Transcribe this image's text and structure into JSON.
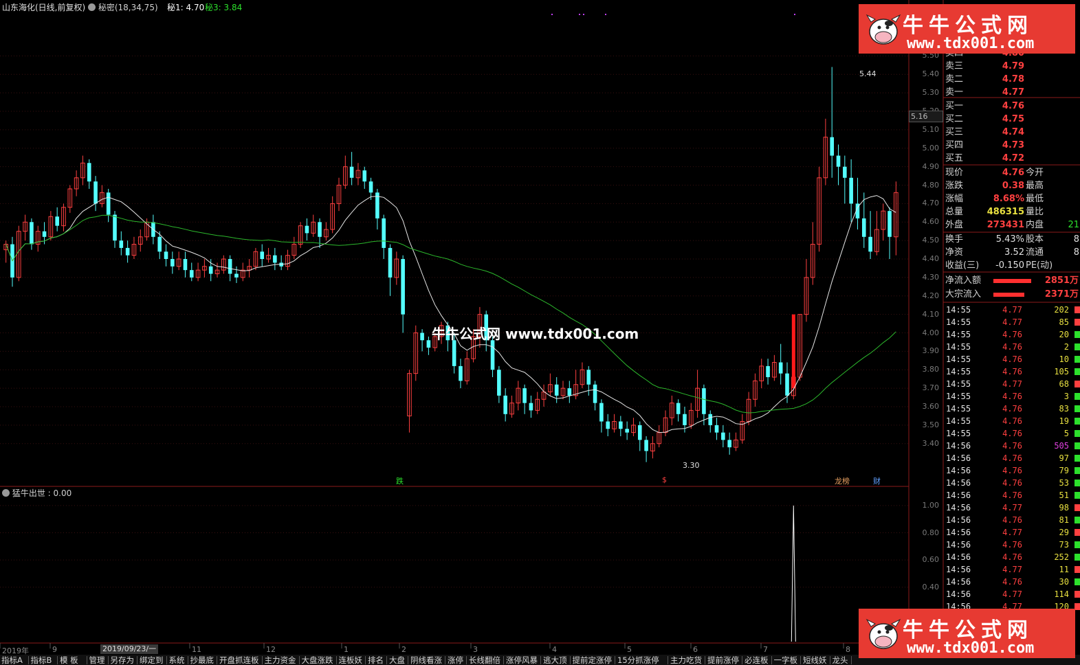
{
  "header": {
    "stock_title": "山东海化(日线,前复权)",
    "formula_name": "秘密(18,34,75)",
    "mi1_label": "秘1: 4.70",
    "mi3_label": "秘3: 3.84"
  },
  "sub_indicator": {
    "label": "猛牛出世 : 0.00"
  },
  "watermark": {
    "center_text": "牛牛公式网 www.tdx001.com",
    "brand_name": "牛牛公式网",
    "brand_url": "www.tdx001.com"
  },
  "price_axis": {
    "labels": [
      "5.50",
      "5.40",
      "5.30",
      "5.20",
      "5.10",
      "5.00",
      "4.90",
      "4.80",
      "4.70",
      "4.60",
      "4.50",
      "4.40",
      "4.30",
      "4.20",
      "4.10",
      "4.00",
      "3.90",
      "3.80",
      "3.70",
      "3.60",
      "3.50",
      "3.40"
    ],
    "current_marker": "5.16"
  },
  "sub_axis": {
    "labels": [
      "1.00",
      "0.80",
      "0.60",
      "0.40"
    ]
  },
  "annotations": {
    "high_label": "5.44",
    "low_label": "3.30",
    "marker_die": "跌",
    "marker_dollar": "$",
    "marker_bang": "龙榜",
    "marker_cai": "财"
  },
  "x_axis": {
    "labels": [
      "2019年",
      "9",
      "11",
      "12",
      "1",
      "2",
      "3",
      "4",
      "5",
      "6",
      "7",
      "8"
    ],
    "cursor_date": "2019/09/23/一"
  },
  "order_book": {
    "asks": [
      {
        "label": "卖四",
        "price": "4.80"
      },
      {
        "label": "卖三",
        "price": "4.79"
      },
      {
        "label": "卖二",
        "price": "4.78"
      },
      {
        "label": "卖一",
        "price": "4.77"
      }
    ],
    "bids": [
      {
        "label": "买一",
        "price": "4.76"
      },
      {
        "label": "买二",
        "price": "4.75"
      },
      {
        "label": "买三",
        "price": "4.74"
      },
      {
        "label": "买四",
        "price": "4.73"
      },
      {
        "label": "买五",
        "price": "4.72"
      }
    ]
  },
  "quote": [
    {
      "l1": "现价",
      "v1": "4.76",
      "l2": "今开",
      "v2": ""
    },
    {
      "l1": "涨跌",
      "v1": "0.38",
      "l2": "最高",
      "v2": ""
    },
    {
      "l1": "涨幅",
      "v1": "8.68%",
      "l2": "最低",
      "v2": ""
    },
    {
      "l1": "总量",
      "v1": "486315",
      "l2": "量比",
      "v2": ""
    },
    {
      "l1": "外盘",
      "v1": "273431",
      "l2": "内盘",
      "v2": "21"
    }
  ],
  "stats": [
    {
      "l1": "换手",
      "v1": "5.43%",
      "l2": "股本",
      "v2": "8"
    },
    {
      "l1": "净资",
      "v1": "3.52",
      "l2": "流通",
      "v2": "8"
    },
    {
      "l1": "收益(三)",
      "v1": "-0.150",
      "l2": "PE(动)",
      "v2": ""
    }
  ],
  "flows": [
    {
      "label": "净流入额",
      "value": "2851万"
    },
    {
      "label": "大宗流入",
      "value": "2371万"
    }
  ],
  "ticks": [
    {
      "time": "14:55",
      "price": "4.77",
      "vol": "202"
    },
    {
      "time": "14:55",
      "price": "4.77",
      "vol": "85"
    },
    {
      "time": "14:55",
      "price": "4.76",
      "vol": "20"
    },
    {
      "time": "14:55",
      "price": "4.76",
      "vol": "2"
    },
    {
      "time": "14:55",
      "price": "4.76",
      "vol": "10"
    },
    {
      "time": "14:55",
      "price": "4.76",
      "vol": "105"
    },
    {
      "time": "14:55",
      "price": "4.77",
      "vol": "68"
    },
    {
      "time": "14:55",
      "price": "4.76",
      "vol": "3"
    },
    {
      "time": "14:55",
      "price": "4.76",
      "vol": "83"
    },
    {
      "time": "14:55",
      "price": "4.76",
      "vol": "19"
    },
    {
      "time": "14:55",
      "price": "4.76",
      "vol": "5"
    },
    {
      "time": "14:56",
      "price": "4.76",
      "vol": "505"
    },
    {
      "time": "14:56",
      "price": "4.76",
      "vol": "97"
    },
    {
      "time": "14:56",
      "price": "4.76",
      "vol": "79"
    },
    {
      "time": "14:56",
      "price": "4.76",
      "vol": "53"
    },
    {
      "time": "14:56",
      "price": "4.76",
      "vol": "51"
    },
    {
      "time": "14:56",
      "price": "4.77",
      "vol": "98"
    },
    {
      "time": "14:56",
      "price": "4.76",
      "vol": "81"
    },
    {
      "time": "14:56",
      "price": "4.77",
      "vol": "29"
    },
    {
      "time": "14:56",
      "price": "4.76",
      "vol": "73"
    },
    {
      "time": "14:56",
      "price": "4.76",
      "vol": "252"
    },
    {
      "time": "14:56",
      "price": "4.77",
      "vol": "11"
    },
    {
      "time": "14:56",
      "price": "4.76",
      "vol": "30"
    },
    {
      "time": "14:56",
      "price": "4.77",
      "vol": "114"
    },
    {
      "time": "14:56",
      "price": "4.77",
      "vol": "120"
    }
  ],
  "tabs": [
    "指标A",
    "指标B",
    "模 板",
    "管理",
    "另存为",
    "绑定到",
    "系统",
    "抄最底",
    "开盘抓连板",
    "主力资金",
    "大盘涨跌",
    "连板妖",
    "排名",
    "大盘",
    "阴线看涨",
    "涨停",
    "长线翻倍",
    "涨停风暴",
    "逃大顶",
    "提前定涨停",
    "15分抓涨停",
    "主力吃货",
    "提前涨停",
    "必连板",
    "一字板",
    "短线妖",
    "龙头"
  ],
  "colors": {
    "up": "#ff4040",
    "down": "#54ffff",
    "ma_short": "#e6e6e6",
    "ma_long": "#2cb82c",
    "brand": "#e73a32"
  },
  "chart_data": {
    "type": "candlestick",
    "ylim": [
      3.28,
      5.55
    ],
    "sub_ylim": [
      0,
      1.05
    ],
    "candles": [
      [
        4.45,
        4.48,
        4.38,
        4.5
      ],
      [
        4.48,
        4.3,
        4.25,
        4.52
      ],
      [
        4.3,
        4.55,
        4.28,
        4.58
      ],
      [
        4.55,
        4.6,
        4.5,
        4.64
      ],
      [
        4.6,
        4.48,
        4.45,
        4.62
      ],
      [
        4.48,
        4.55,
        4.44,
        4.58
      ],
      [
        4.55,
        4.52,
        4.48,
        4.6
      ],
      [
        4.52,
        4.63,
        4.5,
        4.66
      ],
      [
        4.63,
        4.58,
        4.55,
        4.68
      ],
      [
        4.58,
        4.68,
        4.55,
        4.7
      ],
      [
        4.68,
        4.78,
        4.65,
        4.8
      ],
      [
        4.78,
        4.84,
        4.74,
        4.88
      ],
      [
        4.84,
        4.92,
        4.8,
        4.96
      ],
      [
        4.92,
        4.82,
        4.78,
        4.94
      ],
      [
        4.82,
        4.7,
        4.66,
        4.85
      ],
      [
        4.7,
        4.76,
        4.68,
        4.8
      ],
      [
        4.76,
        4.64,
        4.6,
        4.78
      ],
      [
        4.64,
        4.5,
        4.46,
        4.66
      ],
      [
        4.5,
        4.46,
        4.42,
        4.55
      ],
      [
        4.46,
        4.42,
        4.38,
        4.5
      ],
      [
        4.42,
        4.48,
        4.4,
        4.52
      ],
      [
        4.48,
        4.52,
        4.44,
        4.56
      ],
      [
        4.52,
        4.6,
        4.5,
        4.62
      ],
      [
        4.6,
        4.52,
        4.48,
        4.64
      ],
      [
        4.52,
        4.44,
        4.4,
        4.55
      ],
      [
        4.44,
        4.4,
        4.36,
        4.48
      ],
      [
        4.4,
        4.36,
        4.32,
        4.44
      ],
      [
        4.36,
        4.4,
        4.34,
        4.44
      ],
      [
        4.4,
        4.34,
        4.3,
        4.44
      ],
      [
        4.34,
        4.3,
        4.28,
        4.38
      ],
      [
        4.3,
        4.34,
        4.28,
        4.38
      ],
      [
        4.34,
        4.36,
        4.3,
        4.4
      ],
      [
        4.36,
        4.32,
        4.28,
        4.4
      ],
      [
        4.32,
        4.34,
        4.3,
        4.38
      ],
      [
        4.34,
        4.4,
        4.32,
        4.42
      ],
      [
        4.4,
        4.32,
        4.28,
        4.42
      ],
      [
        4.32,
        4.3,
        4.27,
        4.36
      ],
      [
        4.3,
        4.34,
        4.28,
        4.38
      ],
      [
        4.34,
        4.36,
        4.3,
        4.4
      ],
      [
        4.36,
        4.44,
        4.34,
        4.46
      ],
      [
        4.44,
        4.4,
        4.36,
        4.48
      ],
      [
        4.4,
        4.42,
        4.38,
        4.46
      ],
      [
        4.42,
        4.38,
        4.34,
        4.46
      ],
      [
        4.38,
        4.36,
        4.34,
        4.42
      ],
      [
        4.36,
        4.42,
        4.34,
        4.45
      ],
      [
        4.42,
        4.48,
        4.4,
        4.52
      ],
      [
        4.48,
        4.58,
        4.46,
        4.6
      ],
      [
        4.58,
        4.54,
        4.5,
        4.62
      ],
      [
        4.54,
        4.6,
        4.52,
        4.64
      ],
      [
        4.6,
        4.52,
        4.46,
        4.62
      ],
      [
        4.52,
        4.56,
        4.5,
        4.6
      ],
      [
        4.56,
        4.7,
        4.54,
        4.74
      ],
      [
        4.7,
        4.8,
        4.66,
        4.84
      ],
      [
        4.8,
        4.9,
        4.78,
        4.96
      ],
      [
        4.9,
        4.84,
        4.8,
        4.98
      ],
      [
        4.84,
        4.88,
        4.8,
        4.92
      ],
      [
        4.88,
        4.82,
        4.78,
        4.9
      ],
      [
        4.82,
        4.76,
        4.72,
        4.84
      ],
      [
        4.76,
        4.62,
        4.56,
        4.78
      ],
      [
        4.62,
        4.46,
        4.4,
        4.64
      ],
      [
        4.46,
        4.3,
        4.2,
        4.48
      ],
      [
        4.3,
        4.4,
        4.26,
        4.44
      ],
      [
        4.4,
        4.1,
        4.0,
        4.42
      ],
      [
        3.55,
        3.78,
        3.46,
        3.8
      ],
      [
        3.78,
        4.0,
        3.74,
        4.04
      ],
      [
        4.0,
        3.96,
        3.9,
        4.02
      ],
      [
        3.96,
        3.92,
        3.88,
        3.98
      ],
      [
        3.92,
        3.98,
        3.9,
        4.0
      ],
      [
        3.98,
        4.04,
        3.94,
        4.06
      ],
      [
        4.04,
        3.96,
        3.9,
        4.06
      ],
      [
        3.96,
        3.82,
        3.78,
        4.0
      ],
      [
        3.82,
        3.74,
        3.7,
        3.86
      ],
      [
        3.74,
        3.86,
        3.72,
        3.9
      ],
      [
        3.86,
        3.98,
        3.84,
        4.02
      ],
      [
        3.98,
        4.1,
        3.92,
        4.14
      ],
      [
        4.1,
        3.96,
        3.9,
        4.12
      ],
      [
        3.96,
        3.8,
        3.76,
        3.98
      ],
      [
        3.8,
        3.66,
        3.62,
        3.82
      ],
      [
        3.66,
        3.56,
        3.52,
        3.7
      ],
      [
        3.56,
        3.62,
        3.54,
        3.66
      ],
      [
        3.62,
        3.7,
        3.58,
        3.74
      ],
      [
        3.7,
        3.62,
        3.56,
        3.72
      ],
      [
        3.62,
        3.58,
        3.54,
        3.66
      ],
      [
        3.58,
        3.64,
        3.56,
        3.68
      ],
      [
        3.64,
        3.68,
        3.6,
        3.72
      ],
      [
        3.68,
        3.72,
        3.66,
        3.78
      ],
      [
        3.72,
        3.66,
        3.62,
        3.76
      ],
      [
        3.66,
        3.7,
        3.64,
        3.74
      ],
      [
        3.7,
        3.66,
        3.62,
        3.74
      ],
      [
        3.66,
        3.72,
        3.64,
        3.8
      ],
      [
        3.72,
        3.8,
        3.7,
        3.84
      ],
      [
        3.8,
        3.72,
        3.66,
        3.82
      ],
      [
        3.72,
        3.62,
        3.58,
        3.74
      ],
      [
        3.62,
        3.52,
        3.46,
        3.64
      ],
      [
        3.52,
        3.48,
        3.44,
        3.56
      ],
      [
        3.48,
        3.52,
        3.46,
        3.56
      ],
      [
        3.52,
        3.48,
        3.44,
        3.55
      ],
      [
        3.48,
        3.46,
        3.42,
        3.52
      ],
      [
        3.46,
        3.5,
        3.44,
        3.54
      ],
      [
        3.5,
        3.42,
        3.36,
        3.52
      ],
      [
        3.42,
        3.36,
        3.3,
        3.44
      ],
      [
        3.36,
        3.4,
        3.32,
        3.44
      ],
      [
        3.4,
        3.46,
        3.38,
        3.5
      ],
      [
        3.46,
        3.54,
        3.44,
        3.58
      ],
      [
        3.54,
        3.62,
        3.5,
        3.66
      ],
      [
        3.62,
        3.56,
        3.52,
        3.64
      ],
      [
        3.56,
        3.5,
        3.46,
        3.6
      ],
      [
        3.5,
        3.58,
        3.48,
        3.62
      ],
      [
        3.58,
        3.7,
        3.54,
        3.8
      ],
      [
        3.7,
        3.56,
        3.5,
        3.72
      ],
      [
        3.56,
        3.5,
        3.46,
        3.58
      ],
      [
        3.5,
        3.46,
        3.42,
        3.54
      ],
      [
        3.46,
        3.42,
        3.38,
        3.5
      ],
      [
        3.42,
        3.38,
        3.34,
        3.46
      ],
      [
        3.38,
        3.42,
        3.36,
        3.46
      ],
      [
        3.42,
        3.52,
        3.4,
        3.56
      ],
      [
        3.52,
        3.64,
        3.5,
        3.68
      ],
      [
        3.64,
        3.74,
        3.6,
        3.78
      ],
      [
        3.74,
        3.82,
        3.7,
        3.86
      ],
      [
        3.82,
        3.76,
        3.72,
        3.86
      ],
      [
        3.76,
        3.84,
        3.74,
        3.88
      ],
      [
        3.84,
        3.78,
        3.72,
        3.94
      ],
      [
        3.78,
        3.66,
        3.62,
        3.84
      ],
      [
        3.66,
        3.76,
        3.64,
        3.8
      ],
      [
        3.76,
        4.1,
        3.74,
        4.1
      ],
      [
        4.1,
        4.3,
        4.06,
        4.4
      ],
      [
        4.3,
        4.48,
        4.26,
        4.6
      ],
      [
        4.48,
        4.84,
        4.44,
        4.9
      ],
      [
        4.84,
        5.06,
        4.8,
        5.16
      ],
      [
        5.06,
        4.96,
        4.84,
        5.44
      ],
      [
        4.96,
        4.9,
        4.8,
        5.02
      ],
      [
        4.9,
        4.84,
        4.7,
        4.96
      ],
      [
        4.84,
        4.7,
        4.6,
        4.94
      ],
      [
        4.7,
        4.62,
        4.56,
        4.84
      ],
      [
        4.62,
        4.52,
        4.46,
        4.76
      ],
      [
        4.52,
        4.44,
        4.4,
        4.66
      ],
      [
        4.44,
        4.56,
        4.42,
        4.66
      ],
      [
        4.56,
        4.66,
        4.5,
        4.7
      ],
      [
        4.66,
        4.52,
        4.4,
        4.68
      ],
      [
        4.52,
        4.76,
        4.42,
        4.82
      ]
    ],
    "signal_bar_index": 123,
    "spike_index": 123,
    "spike_value": 1.0
  }
}
